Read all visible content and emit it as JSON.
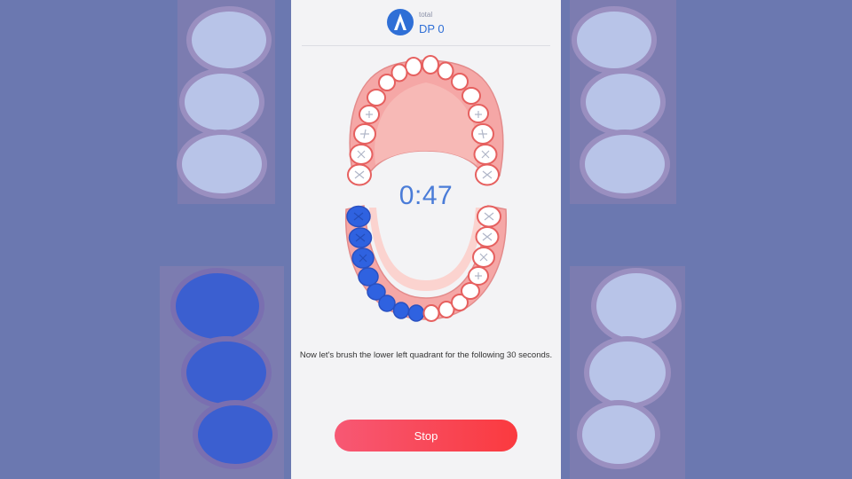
{
  "header": {
    "logo_icon": "toothbrush-a-logo-icon",
    "total_label": "total",
    "dp_value": "DP 0"
  },
  "timer": "0:47",
  "instruction": "Now let's brush the lower left quadrant for the following 30 seconds.",
  "stop_button": {
    "label": "Stop"
  },
  "colors": {
    "accent_blue": "#2f6fd6",
    "brushed_tooth": "#2f62e0",
    "gum": "#f5a7a6",
    "button_start": "#f75874",
    "button_end": "#fa3a3f",
    "overlay": "#6b78b0"
  }
}
